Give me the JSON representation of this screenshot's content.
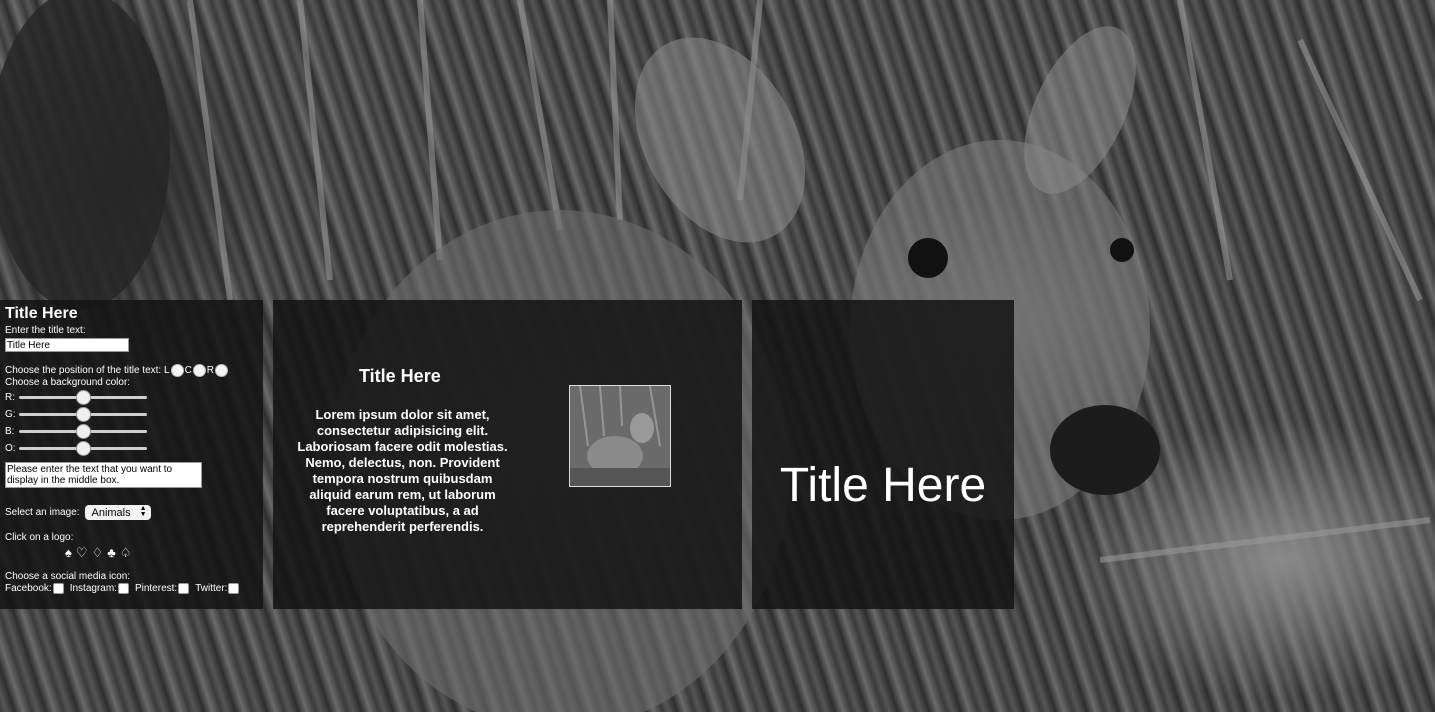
{
  "controls": {
    "heading": "Title Here",
    "title_label": "Enter the title text:",
    "title_value": "Title Here",
    "position_label": "Choose the position of the title text:",
    "position_options": [
      "L",
      "C",
      "R"
    ],
    "bg_label": "Choose a background color:",
    "sliders": [
      {
        "label": "R:",
        "value": 0.5
      },
      {
        "label": "G:",
        "value": 0.5
      },
      {
        "label": "B:",
        "value": 0.5
      },
      {
        "label": "O:",
        "value": 0.5
      }
    ],
    "message_text": "Please enter the text that you want to display in the middle box.",
    "image_label": "Select an image:",
    "image_selected": "Animals",
    "logo_label": "Click on a logo:",
    "logos": [
      "♠",
      "♡",
      "♢",
      "♣",
      "♤"
    ],
    "social_label": "Choose a social media icon:",
    "social": [
      "Facebook:",
      "Instagram:",
      "Pinterest:",
      "Twitter:"
    ]
  },
  "middle": {
    "title": "Title Here",
    "body": "Lorem ipsum dolor sit amet, consectetur adipisicing elit. Laboriosam facere odit molestias. Nemo, delectus, non. Provident tempora nostrum quibusdam aliquid earum rem, ut laborum facere voluptatibus, a ad reprehenderit perferendis."
  },
  "right": {
    "title": "Title Here"
  }
}
